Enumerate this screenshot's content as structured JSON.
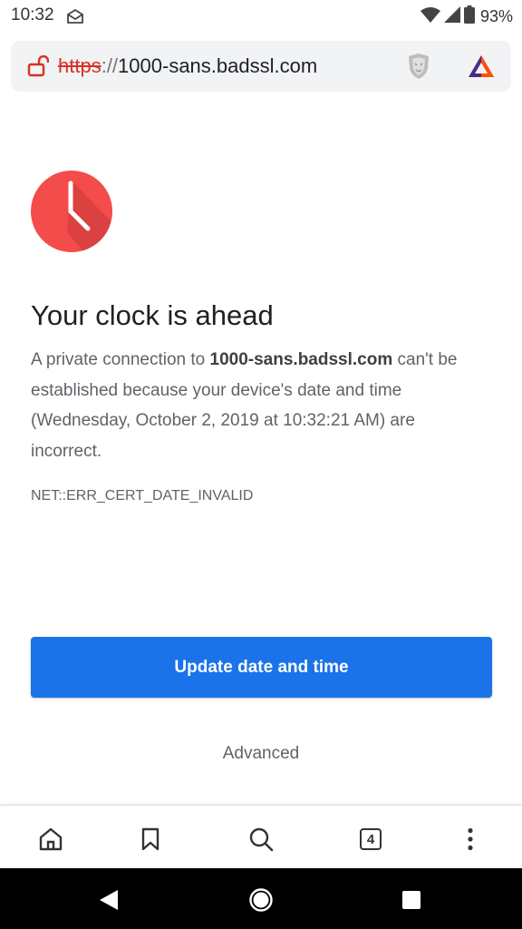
{
  "status_bar": {
    "time": "10:32",
    "battery": "93%",
    "icons": [
      "message-icon",
      "wifi-icon",
      "cell-signal-icon",
      "battery-icon"
    ]
  },
  "url_bar": {
    "scheme": "https",
    "separator": "://",
    "host": "1000-sans.badssl.com",
    "icons": [
      "lock-open-icon",
      "brave-shield-icon",
      "brave-rewards-icon"
    ]
  },
  "error": {
    "title": "Your clock is ahead",
    "desc_part1": "A private connection to ",
    "desc_host": "1000-sans.badssl.com",
    "desc_part2": " can't be established because your device's date and time (Wednesday, October 2, 2019 at 10:32:21 AM) are incorrect.",
    "code": "NET::ERR_CERT_DATE_INVALID",
    "icon": "clock-icon"
  },
  "actions": {
    "primary_label": "Update date and time",
    "advanced_label": "Advanced"
  },
  "toolbar": {
    "tab_count": "4",
    "icons": [
      "home-icon",
      "bookmark-icon",
      "search-icon",
      "tabs-icon",
      "menu-icon"
    ]
  },
  "nav_bar": {
    "icons": [
      "back-icon",
      "home-circle-icon",
      "recents-icon"
    ]
  },
  "colors": {
    "accent": "#1a73e8",
    "error_red": "#f44b4b",
    "scheme_red": "#d93025"
  }
}
